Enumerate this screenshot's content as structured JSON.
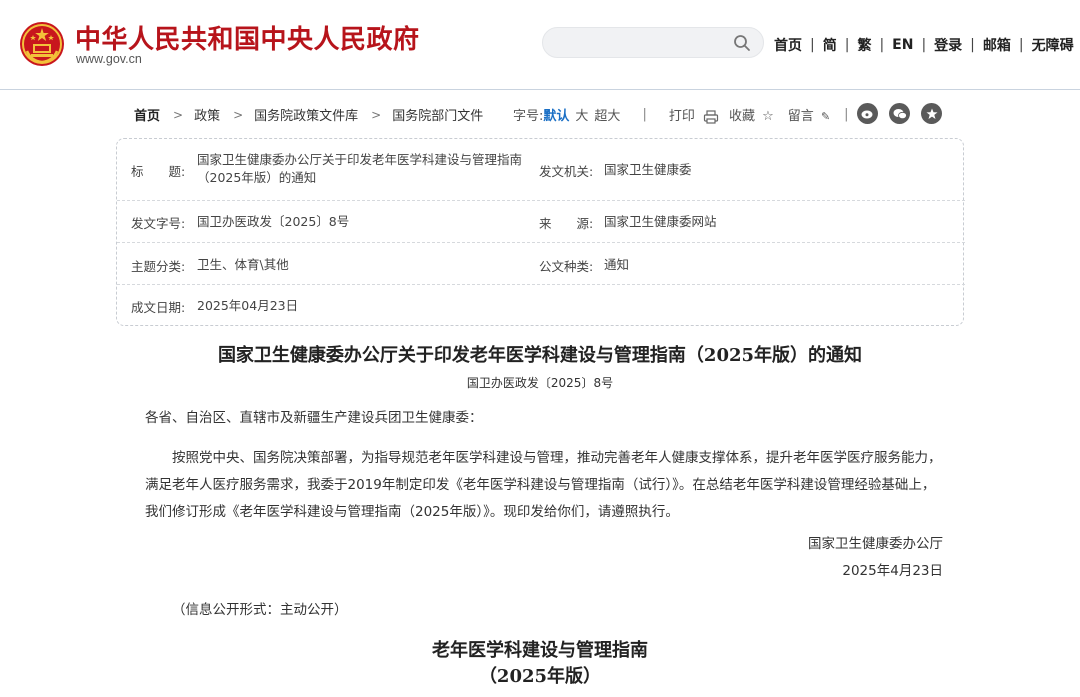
{
  "header": {
    "site_title": "中华人民共和国中央人民政府",
    "site_url": "www.gov.cn",
    "search_placeholder": "",
    "links": [
      "首页",
      "简",
      "繁",
      "EN",
      "登录",
      "邮箱",
      "无障碍"
    ],
    "brand_color": "#b7141b"
  },
  "breadcrumb": {
    "items": [
      "首页",
      "政策",
      "国务院政策文件库",
      "国务院部门文件"
    ]
  },
  "tools": {
    "font_size_label": "字号:",
    "size_default": "默认",
    "size_large": "大",
    "size_xlarge": "超大",
    "print": "打印",
    "favorite": "收藏",
    "comment": "留言"
  },
  "share_icons": [
    "weibo-icon",
    "wechat-icon",
    "star-icon"
  ],
  "info": {
    "title_label": "标　　题:",
    "title_value": "国家卫生健康委办公厅关于印发老年医学科建设与管理指南（2025年版）的通知",
    "issuer_label": "发文机关:",
    "issuer_value": "国家卫生健康委",
    "doc_no_label": "发文字号:",
    "doc_no_value": "国卫办医政发〔2025〕8号",
    "source_label": "来　　源:",
    "source_value": "国家卫生健康委网站",
    "category_label": "主题分类:",
    "category_value": "卫生、体育\\其他",
    "type_label": "公文种类:",
    "type_value": "通知",
    "date_label": "成文日期:",
    "date_value": "2025年04月23日"
  },
  "document": {
    "title": "国家卫生健康委办公厅关于印发老年医学科建设与管理指南（2025年版）的通知",
    "number": "国卫办医政发〔2025〕8号",
    "addressee": "各省、自治区、直辖市及新疆生产建设兵团卫生健康委：",
    "body": "按照党中央、国务院决策部署，为指导规范老年医学科建设与管理，推动完善老年人健康支撑体系，提升老年医学医疗服务能力，满足老年人医疗服务需求，我委于2019年制定印发《老年医学科建设与管理指南（试行）》。在总结老年医学科建设管理经验基础上，我们修订形成《老年医学科建设与管理指南（2025年版）》。现印发给你们，请遵照执行。",
    "signature": "国家卫生健康委办公厅",
    "date": "2025年4月23日",
    "disclosure": "（信息公开形式：主动公开）",
    "attachment_title": "老年医学科建设与管理指南",
    "attachment_subtitle": "（2025年版）"
  }
}
